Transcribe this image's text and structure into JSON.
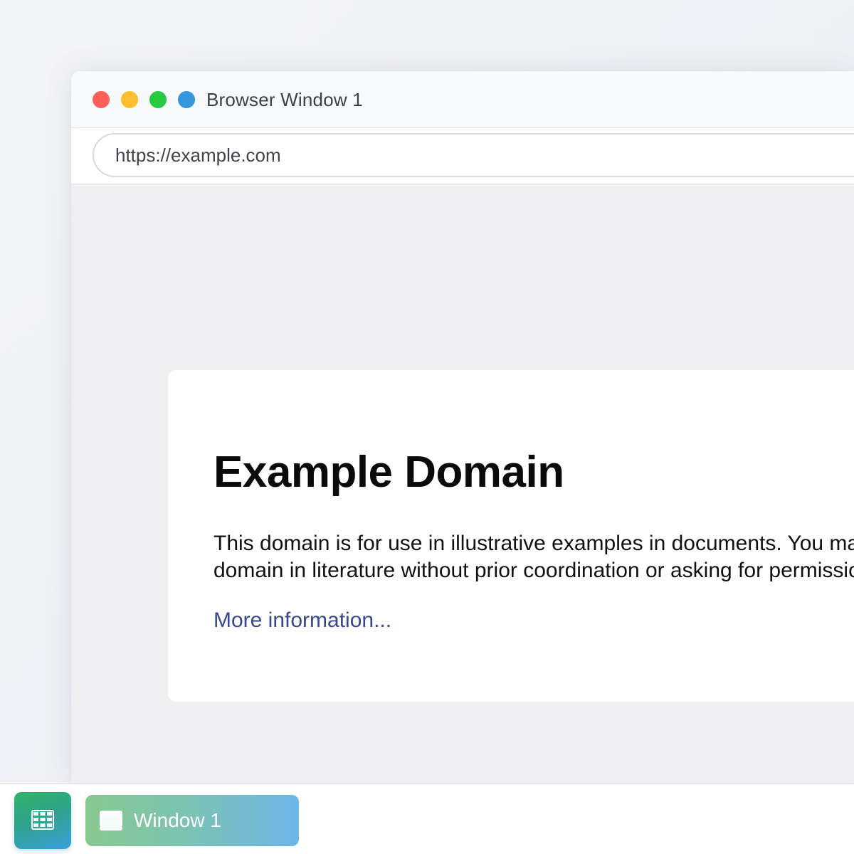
{
  "window": {
    "title": "Browser Window 1",
    "controls": {
      "close_color": "#fe5f57",
      "minimize_color": "#febc2e",
      "maximize_color": "#28c840",
      "extra_color": "#3498db"
    }
  },
  "address_bar": {
    "url": "https://example.com"
  },
  "page": {
    "heading": "Example Domain",
    "paragraph_lines": [
      "This domain is for use in illustrative examples in documents. You may use this",
      "domain in literature without prior coordination or asking for permission."
    ],
    "link_text": "More information..."
  },
  "taskbar": {
    "launcher_icon": "grid-icon",
    "window_icon": "window-icon",
    "task_label": "Window 1"
  }
}
